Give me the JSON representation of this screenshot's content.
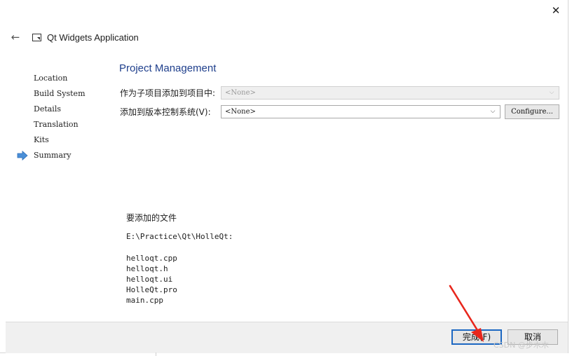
{
  "window": {
    "title": "Qt Widgets Application",
    "close_glyph": "✕",
    "back_glyph": "←"
  },
  "steps": [
    {
      "label": "Location",
      "current": false
    },
    {
      "label": "Build System",
      "current": false
    },
    {
      "label": "Details",
      "current": false
    },
    {
      "label": "Translation",
      "current": false
    },
    {
      "label": "Kits",
      "current": false
    },
    {
      "label": "Summary",
      "current": true
    }
  ],
  "page": {
    "title": "Project Management",
    "subproject_label": "作为子项目添加到项目中:",
    "subproject_value": "<None>",
    "vcs_label": "添加到版本控制系统(V):",
    "vcs_value": "<None>",
    "configure_label": "Configure..."
  },
  "files": {
    "heading": "要添加的文件",
    "path": "E:\\Practice\\Qt\\HolleQt:",
    "list": [
      "helloqt.cpp",
      "helloqt.h",
      "helloqt.ui",
      "HolleQt.pro",
      "main.cpp"
    ]
  },
  "footer": {
    "finish_label": "完成(F)",
    "cancel_label": "取消"
  },
  "watermark": "CSDN @步木木",
  "colors": {
    "accent": "#1d68c2",
    "title_blue": "#1f3f8c",
    "step_arrow": "#4a8fd8",
    "annotation_arrow": "#e8261c"
  }
}
